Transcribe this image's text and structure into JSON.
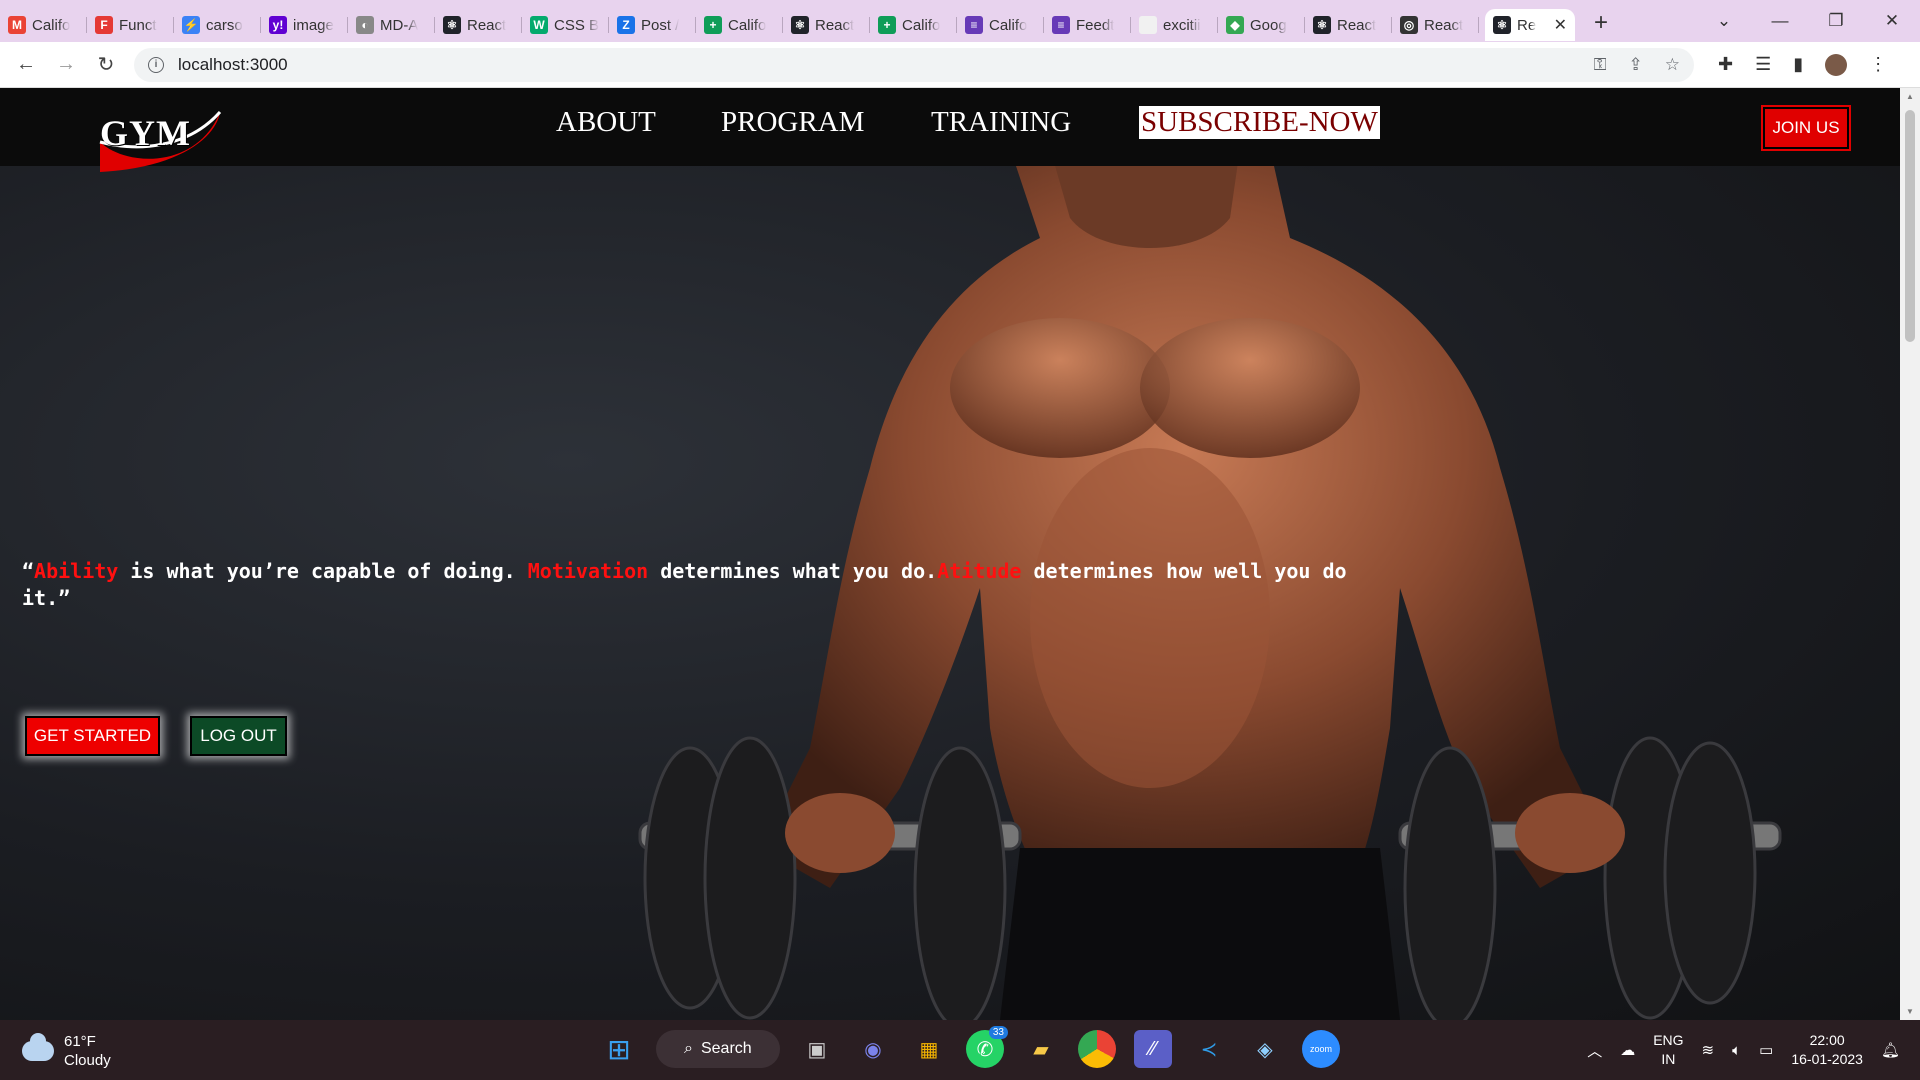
{
  "browser": {
    "tabs": [
      {
        "label": "Califo",
        "icon": "gmail-icon",
        "color": "#ea4335",
        "glyph": "M"
      },
      {
        "label": "Funct",
        "icon": "shield-icon",
        "color": "#e53935",
        "glyph": "F"
      },
      {
        "label": "carso",
        "icon": "bolt-icon",
        "color": "#3b82f6",
        "glyph": "⚡"
      },
      {
        "label": "image",
        "icon": "yahoo-icon",
        "color": "#6001d2",
        "glyph": "y!"
      },
      {
        "label": "MD-A",
        "icon": "github-icon",
        "color": "#888888",
        "glyph": "◐"
      },
      {
        "label": "React",
        "icon": "react-icon",
        "color": "#20232a",
        "glyph": "⚛"
      },
      {
        "label": "CSS B",
        "icon": "w3-icon",
        "color": "#04aa6d",
        "glyph": "W"
      },
      {
        "label": "Post /",
        "icon": "zoho-icon",
        "color": "#1a73e8",
        "glyph": "Z"
      },
      {
        "label": "Califo",
        "icon": "sheets-icon",
        "color": "#0f9d58",
        "glyph": "+"
      },
      {
        "label": "React",
        "icon": "react-icon",
        "color": "#20232a",
        "glyph": "⚛"
      },
      {
        "label": "Califo",
        "icon": "sheets-icon",
        "color": "#0f9d58",
        "glyph": "+"
      },
      {
        "label": "Califo",
        "icon": "forms-icon",
        "color": "#673ab7",
        "glyph": "≡"
      },
      {
        "label": "Feedt",
        "icon": "forms-icon",
        "color": "#673ab7",
        "glyph": "≡"
      },
      {
        "label": "excitii",
        "icon": "blank-page-icon",
        "color": "#f1f1f1",
        "glyph": ""
      },
      {
        "label": "Goog",
        "icon": "google-photos-icon",
        "color": "#34a853",
        "glyph": "◆"
      },
      {
        "label": "React",
        "icon": "react-icon",
        "color": "#20232a",
        "glyph": "⚛"
      },
      {
        "label": "React",
        "icon": "globe-icon",
        "color": "#333333",
        "glyph": "◎"
      }
    ],
    "active_tab": {
      "label": "Re",
      "icon": "react-icon",
      "glyph": "⚛"
    },
    "url": "localhost:3000"
  },
  "site": {
    "logo": "GYM",
    "nav": {
      "about": "ABOUT",
      "program": "PROGRAM",
      "training": "TRAINING",
      "subscribe": "SUBSCRIBE-NOW"
    },
    "join_label": "JOIN US",
    "quote": {
      "open": "“",
      "w1": "Ability",
      "t1": " is what you’re capable of doing. ",
      "w2": "Motivation",
      "t2": " determines what you do.",
      "w3": "Atitude",
      "t3": " determines how well you do it.”"
    },
    "get_started_label": "GET STARTED",
    "logout_label": "LOG OUT",
    "accent_color": "#ee0000"
  },
  "taskbar": {
    "temperature": "61°F",
    "condition": "Cloudy",
    "search_label": "Search",
    "whatsapp_badge": "33",
    "lang_line1": "ENG",
    "lang_line2": "IN",
    "time": "22:00",
    "date": "16-01-2023"
  }
}
